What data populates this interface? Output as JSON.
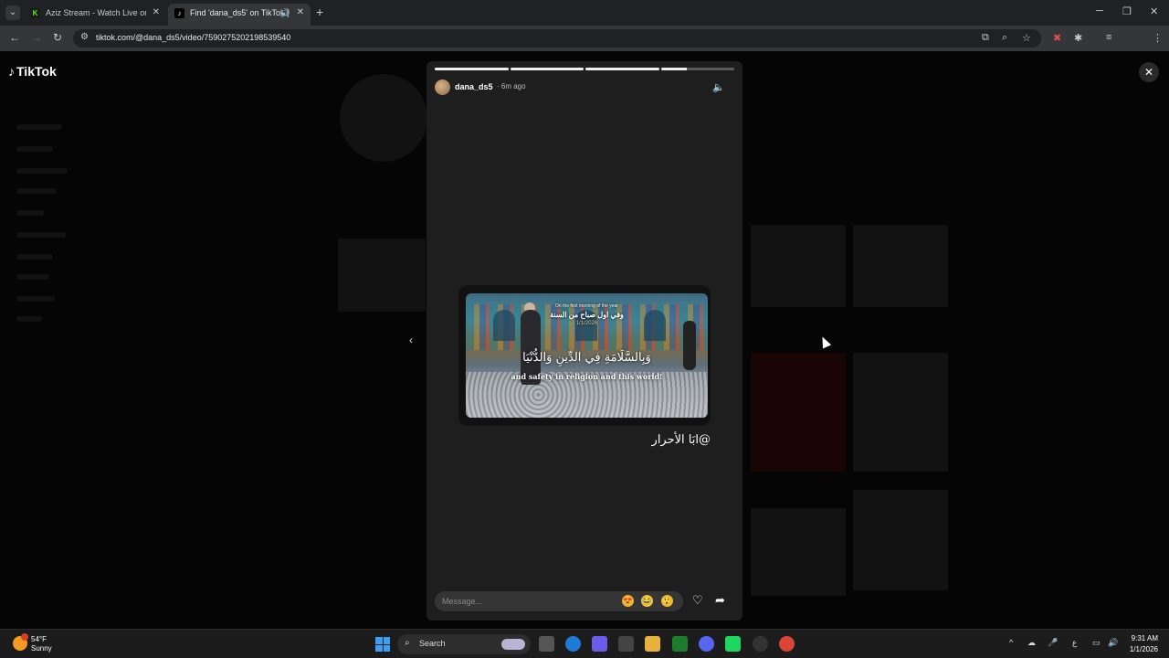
{
  "browser": {
    "tabs": [
      {
        "title": "Aziz Stream - Watch Live on Ki",
        "favicon": "kick-icon"
      },
      {
        "title": "Find 'dana_ds5' on TikTok |",
        "favicon": "tiktok-icon",
        "active": true
      }
    ],
    "url": "tiktok.com/@dana_ds5/video/7590275202198539540"
  },
  "page": {
    "logo_text": "TikTok"
  },
  "story": {
    "progress": [
      1,
      1,
      1,
      0.35
    ],
    "username": "dana_ds5",
    "time_ago": "· 6m ago",
    "caption_en_top": "On the first morning of the year",
    "caption_ar_top": "وفي اول صباح من السنة",
    "caption_date": "1/1/2026",
    "caption_ar_main": "وَبِالسَّلَامَةِ فِي الدِّينِ وَالدُّنْيَا",
    "caption_en_main": "and safety in religion and this world!",
    "mention": "@ابَا الأحرار",
    "message_placeholder": "Message..."
  },
  "taskbar": {
    "weather_temp": "54°F",
    "weather_cond": "Sunny",
    "search_label": "Search",
    "clock_time": "9:31 AM",
    "clock_date": "1/1/2026"
  }
}
